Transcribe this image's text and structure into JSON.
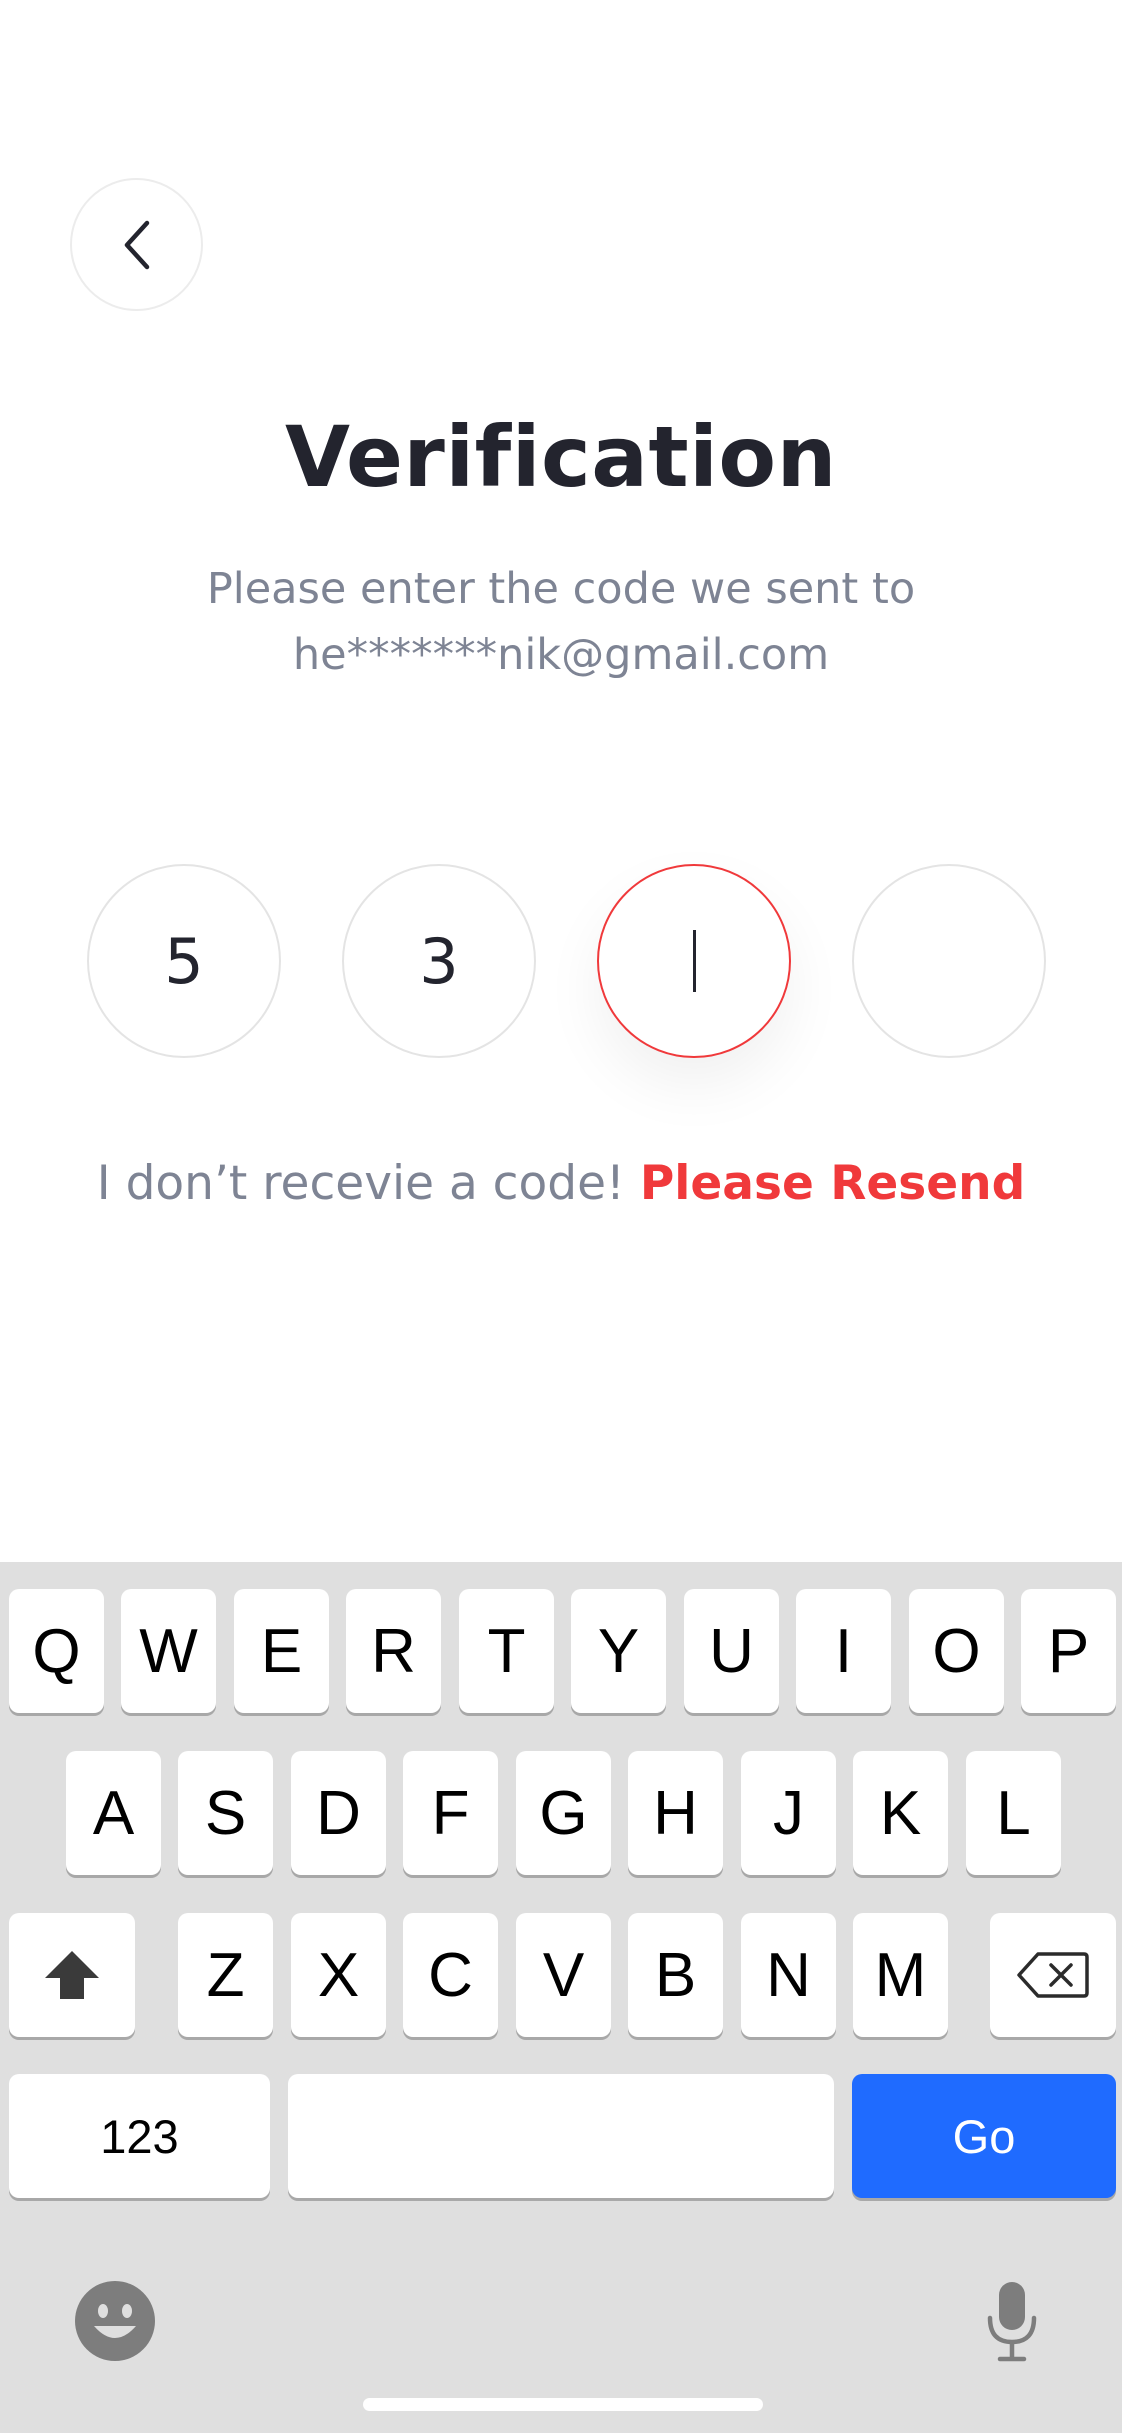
{
  "header": {
    "back_label": ""
  },
  "verification": {
    "title": "Verification",
    "subtitle_line1": "Please enter the code we sent to",
    "subtitle_line2": "he*******nik@gmail.com",
    "code_digits": [
      "5",
      "3",
      "",
      ""
    ],
    "resend_prompt": "I don’t recevie a code!",
    "resend_link": "Please Resend"
  },
  "keyboard": {
    "row1": [
      "Q",
      "W",
      "E",
      "R",
      "T",
      "Y",
      "U",
      "I",
      "O",
      "P"
    ],
    "row2": [
      "A",
      "S",
      "D",
      "F",
      "G",
      "H",
      "J",
      "K",
      "L"
    ],
    "row3": [
      "Z",
      "X",
      "C",
      "V",
      "B",
      "N",
      "M"
    ],
    "numbers_key": "123",
    "go_key": "Go"
  },
  "colors": {
    "accent": "#f0393b",
    "go_key": "#1f6bff",
    "title": "#23242e",
    "muted": "#7e8494"
  },
  "icons": [
    "chevron-left-icon",
    "shift-icon",
    "backspace-icon",
    "emoji-icon",
    "microphone-icon"
  ]
}
